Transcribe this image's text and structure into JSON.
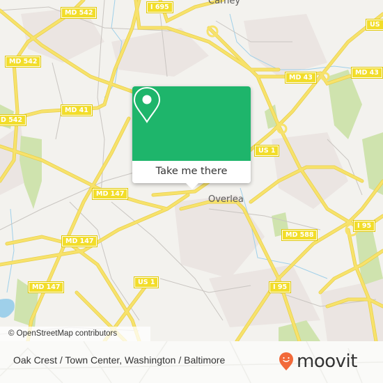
{
  "map": {
    "place_labels": [
      {
        "name": "carney",
        "text": "Carney"
      },
      {
        "name": "overlea",
        "text": "Overlea"
      }
    ],
    "road_shields": [
      {
        "name": "md-542-top",
        "text": "MD 542"
      },
      {
        "name": "i-695",
        "text": "I 695"
      },
      {
        "name": "md-542-left",
        "text": "MD 542"
      },
      {
        "name": "md-542-edge",
        "text": "D 542"
      },
      {
        "name": "md-41",
        "text": "MD 41"
      },
      {
        "name": "md-43-center",
        "text": "MD 43"
      },
      {
        "name": "md-43-right",
        "text": "MD 43"
      },
      {
        "name": "us-1-top-right",
        "text": "US"
      },
      {
        "name": "us-1-center",
        "text": "US 1"
      },
      {
        "name": "md-147-upper",
        "text": "MD 147"
      },
      {
        "name": "md-147-middle",
        "text": "MD 147"
      },
      {
        "name": "md-147-lower",
        "text": "MD 147"
      },
      {
        "name": "md-588",
        "text": "MD 588"
      },
      {
        "name": "i-95-right",
        "text": "I 95"
      },
      {
        "name": "us-1-lower",
        "text": "US 1"
      },
      {
        "name": "i-95-lower",
        "text": "I 95"
      }
    ],
    "attribution": "© OpenStreetMap contributors",
    "colors": {
      "road": "#f7e26b",
      "park": "#cfe3ae",
      "water": "#9fd0ea",
      "land": "#f3f2ee",
      "urban": "#ebe5e2"
    }
  },
  "popup": {
    "icon": "map-pin-icon",
    "action_label": "Take me there",
    "color": "#1eb56b"
  },
  "footer": {
    "title": "Oak Crest / Town Center, Washington / Baltimore",
    "brand": "moovit",
    "brand_icon": "moovit-pin-smile-icon",
    "brand_color": "#f26a3a"
  }
}
